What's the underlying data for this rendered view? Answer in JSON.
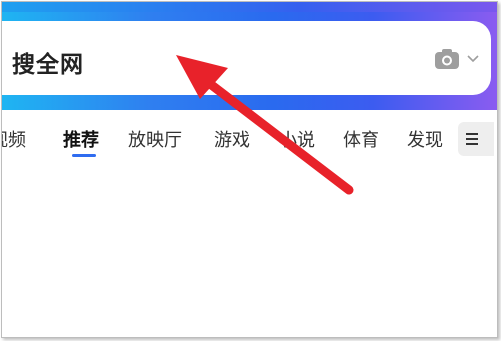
{
  "search": {
    "text": "搜全网",
    "camera_icon": "camera-icon",
    "chevron_icon": "chevron-down-icon"
  },
  "tabs": [
    {
      "label": "视频",
      "active": false
    },
    {
      "label": "推荐",
      "active": true
    },
    {
      "label": "放映厅",
      "active": false
    },
    {
      "label": "游戏",
      "active": false
    },
    {
      "label": "小说",
      "active": false
    },
    {
      "label": "体育",
      "active": false
    },
    {
      "label": "发现",
      "active": false
    }
  ],
  "menu_icon": "menu-icon",
  "colors": {
    "accent": "#2f6cf0",
    "annotation_arrow": "#e8222a"
  }
}
